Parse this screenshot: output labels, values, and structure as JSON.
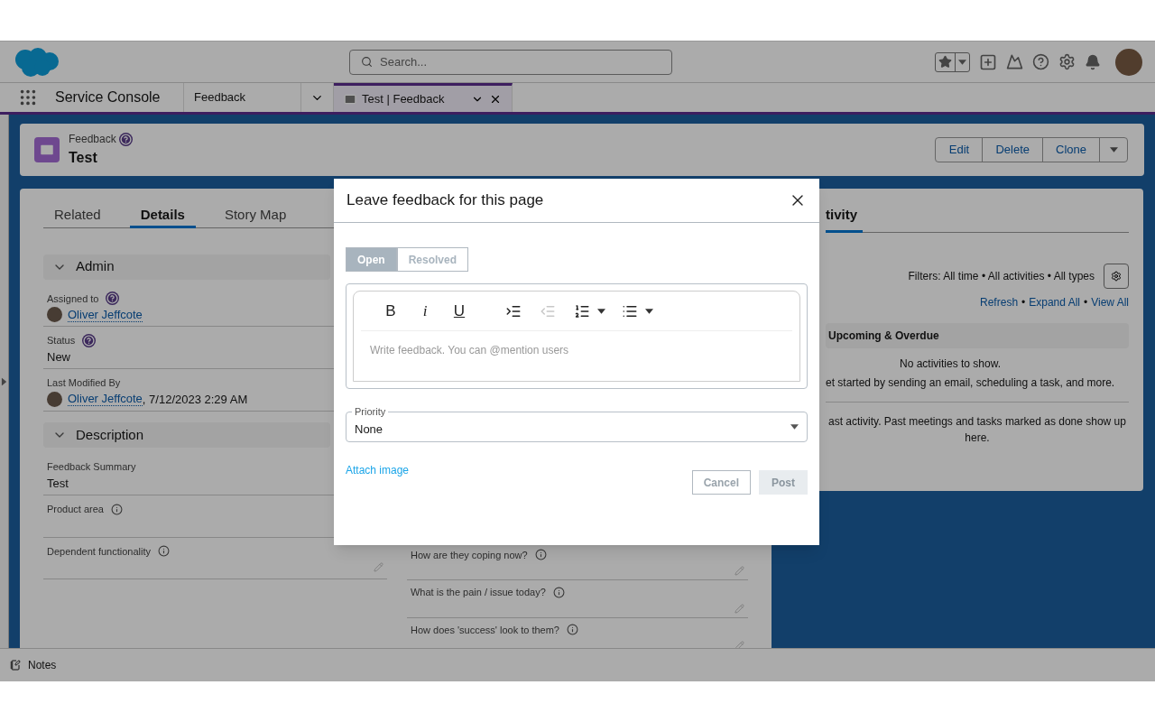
{
  "header": {
    "search": {
      "placeholder": "Search..."
    }
  },
  "nav": {
    "app_name": "Service Console",
    "tabs": [
      {
        "label": "Feedback",
        "selected": false,
        "kind": "object"
      },
      {
        "label": "Test | Feedback",
        "selected": true,
        "kind": "record"
      }
    ]
  },
  "record": {
    "object": "Feedback",
    "title": "Test",
    "actions": [
      "Edit",
      "Delete",
      "Clone"
    ]
  },
  "detail_tabs": [
    {
      "label": "Related",
      "selected": false
    },
    {
      "label": "Details",
      "selected": true
    },
    {
      "label": "Story Map",
      "selected": false
    }
  ],
  "sections": [
    {
      "title": "Admin",
      "expanded": true,
      "fields": [
        {
          "label": "Assigned to",
          "help": true,
          "kind": "user",
          "value": "Oliver Jeffcote",
          "editable": false
        },
        {
          "label": "Status",
          "help": true,
          "kind": "text",
          "value": "New",
          "editable": false
        },
        {
          "label": "Last Modified By",
          "kind": "user",
          "value": "Oliver Jeffcote",
          "suffix": ", 7/12/2023 2:29 AM",
          "editable": false
        }
      ]
    },
    {
      "title": "Description",
      "expanded": true,
      "fields": [
        {
          "label": "Feedback Summary",
          "kind": "text",
          "value": "Test",
          "editable": false
        },
        {
          "label": "Product area",
          "help": true,
          "kind": "text",
          "editable": false
        },
        {
          "label": "Dependent functionality",
          "help": true,
          "kind": "text",
          "editable": true
        }
      ]
    }
  ],
  "right_column_fields": [
    {
      "label": "How are they coping now?",
      "help": true,
      "editable": true
    },
    {
      "label": "What is the pain / issue today?",
      "help": true,
      "editable": true
    },
    {
      "label": "How does 'success' look to them?",
      "help": true,
      "editable": true
    }
  ],
  "activity": {
    "tab": "tivity",
    "filters": "Filters: All time • All activities • All types",
    "links": [
      {
        "label": "Refresh"
      },
      {
        "separator": "•",
        "label": "Expand All"
      },
      {
        "separator": "•",
        "label": "View All"
      }
    ],
    "upcoming": {
      "title": "Upcoming & Overdue",
      "empty": "No activities to show.",
      "hint": "et started by sending an email, scheduling a task, and more."
    },
    "past": "ast activity. Past meetings and tasks marked as done show up here."
  },
  "utility_bar": {
    "items": [
      {
        "label": "Notes"
      }
    ]
  },
  "modal": {
    "title": "Leave feedback for this page",
    "status_tabs": [
      {
        "label": "Open",
        "selected": true
      },
      {
        "label": "Resolved",
        "selected": false
      }
    ],
    "format_buttons": [
      "B",
      "i",
      "U"
    ],
    "tools": [
      {
        "kind": "indent",
        "disabled": false,
        "menu": false
      },
      {
        "kind": "outdent",
        "disabled": true,
        "menu": false
      },
      {
        "kind": "numbered",
        "disabled": false,
        "menu": true
      },
      {
        "kind": "bulleted",
        "disabled": false,
        "menu": true
      }
    ],
    "editor": {
      "placeholder": "Write feedback. You can @mention users"
    },
    "priority": {
      "label": "Priority",
      "value": "None"
    },
    "attach": "Attach image",
    "buttons": [
      {
        "label": "Cancel",
        "disabled": false
      },
      {
        "label": "Post",
        "disabled": true
      }
    ]
  }
}
